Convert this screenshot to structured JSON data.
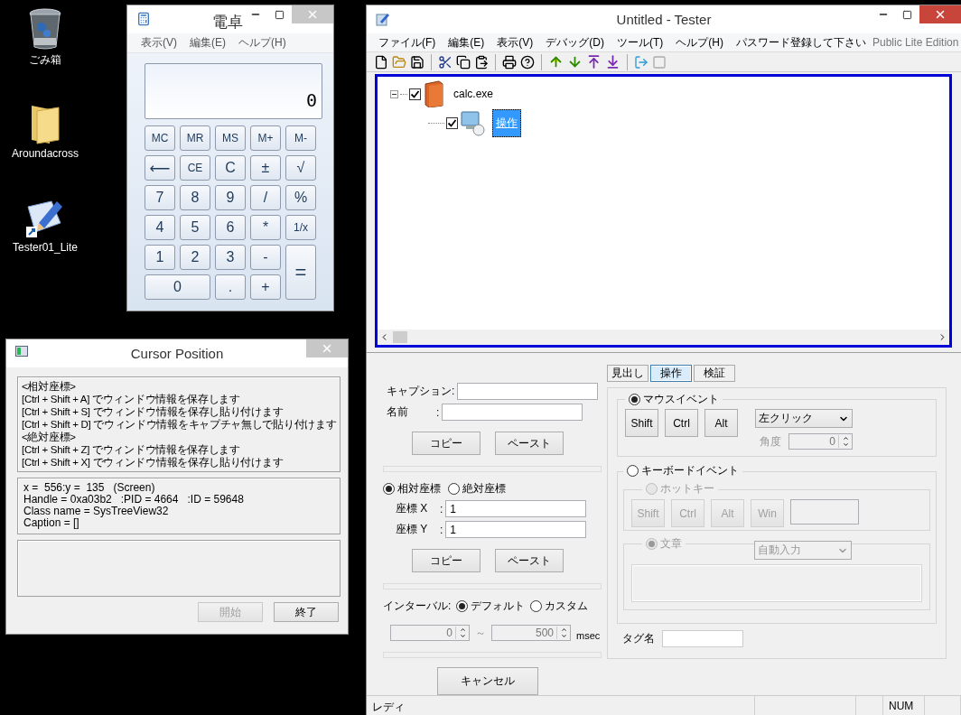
{
  "desktop_icons": [
    {
      "label": "ごみ箱",
      "kind": "trash"
    },
    {
      "label": "Aroundacross",
      "kind": "folder"
    },
    {
      "label": "Tester01_Lite",
      "kind": "shortcut"
    }
  ],
  "calculator": {
    "title": "電卓",
    "menu": [
      "表示(V)",
      "編集(E)",
      "ヘルプ(H)"
    ],
    "display": "0",
    "keys": [
      {
        "label": "MC",
        "kind": "key"
      },
      {
        "label": "MR",
        "kind": "key"
      },
      {
        "label": "MS",
        "kind": "key"
      },
      {
        "label": "M+",
        "kind": "key"
      },
      {
        "label": "M-",
        "kind": "key"
      },
      {
        "label": "⟵",
        "kind": "key"
      },
      {
        "label": "CE",
        "kind": "key"
      },
      {
        "label": "C",
        "kind": "key"
      },
      {
        "label": "±",
        "kind": "key"
      },
      {
        "label": "√",
        "kind": "key"
      },
      {
        "label": "7",
        "kind": "key"
      },
      {
        "label": "8",
        "kind": "key"
      },
      {
        "label": "9",
        "kind": "key"
      },
      {
        "label": "/",
        "kind": "key"
      },
      {
        "label": "%",
        "kind": "key"
      },
      {
        "label": "4",
        "kind": "key"
      },
      {
        "label": "5",
        "kind": "key"
      },
      {
        "label": "6",
        "kind": "key"
      },
      {
        "label": "*",
        "kind": "key"
      },
      {
        "label": "1/x",
        "kind": "key"
      },
      {
        "label": "1",
        "kind": "key"
      },
      {
        "label": "2",
        "kind": "key"
      },
      {
        "label": "3",
        "kind": "key"
      },
      {
        "label": "-",
        "kind": "key"
      },
      {
        "label": "=",
        "kind": "tall"
      },
      {
        "label": "0",
        "kind": "wide"
      },
      {
        "label": ".",
        "kind": "key"
      },
      {
        "label": "+",
        "kind": "key"
      }
    ]
  },
  "cursor_window": {
    "title": "Cursor Position",
    "hotkey_lines": [
      "<相対座標>",
      "[Ctrl + Shift + A] でウィンドウ情報を保存します",
      "[Ctrl + Shift + S] でウィンドウ情報を保存し貼り付けます",
      "[Ctrl + Shift + D] でウィンドウ情報をキャプチャ無しで貼り付けます",
      "<絶対座標>",
      "[Ctrl + Shift + Z] でウィンドウ情報を保存します",
      "[Ctrl + Shift + X] でウィンドウ情報を保存し貼り付けます"
    ],
    "info_lines": [
      "x =  556:y =  135   (Screen)",
      "Handle = 0xa03b2   :PID = 4664   :ID = 59648",
      "Class name = SysTreeView32",
      "Caption = []"
    ],
    "buttons": [
      {
        "label": "開始",
        "disabled": true
      },
      {
        "label": "終了",
        "disabled": false
      }
    ]
  },
  "tester": {
    "title": "Untitled - Tester",
    "menu": [
      "ファイル(F)",
      "編集(E)",
      "表示(V)",
      "デバッグ(D)",
      "ツール(T)",
      "ヘルプ(H)",
      "パスワード登録して下さい"
    ],
    "edition": "Public Lite Edition",
    "tree": [
      {
        "label": "calc.exe",
        "kind": "app",
        "checked": true,
        "expanded": true,
        "selected": false,
        "children": [
          {
            "label": "操作",
            "kind": "action",
            "checked": true,
            "selected": true
          }
        ]
      }
    ],
    "form": {
      "fields": [
        {
          "label": "キャプション:"
        },
        {
          "label": "名前",
          "sep": ":"
        }
      ],
      "buttons": [
        "コピー",
        "ペースト"
      ],
      "coord_modes": [
        {
          "label": "相対座標",
          "selected": true
        },
        {
          "label": "絶対座標",
          "selected": false
        }
      ],
      "coords": [
        {
          "label": "座標 X",
          "sep": ":",
          "value": "1"
        },
        {
          "label": "座標 Y",
          "sep": ":",
          "value": "1"
        }
      ],
      "coord_buttons": [
        "コピー",
        "ペースト"
      ],
      "interval": {
        "label": "インターバル:",
        "modes": [
          {
            "label": "デフォルト",
            "selected": true
          },
          {
            "label": "カスタム",
            "selected": false
          }
        ],
        "from": {
          "value": "0",
          "disabled": true
        },
        "range_sep": "～",
        "to": {
          "value": "500",
          "disabled": true
        },
        "unit": "msec"
      },
      "cancel": "キャンセル"
    },
    "tabs": [
      {
        "label": "見出し",
        "selected": false
      },
      {
        "label": "操作",
        "selected": true
      },
      {
        "label": "検証",
        "selected": false
      }
    ],
    "mouse_event": {
      "label": "マウスイベント",
      "selected": true,
      "buttons": [
        {
          "label": "Shift",
          "disabled": false
        },
        {
          "label": "Ctrl",
          "disabled": false
        },
        {
          "label": "Alt",
          "disabled": false
        }
      ],
      "action": {
        "value": "左クリック",
        "disabled": false
      },
      "angle": {
        "label": "角度",
        "value": "0",
        "disabled": true
      }
    },
    "keyboard_event": {
      "label": "キーボードイベント",
      "selected": false,
      "hotkey": {
        "label": "ホットキー",
        "selected": false,
        "disabled": true,
        "buttons": [
          {
            "label": "Shift",
            "disabled": true
          },
          {
            "label": "Ctrl",
            "disabled": true
          },
          {
            "label": "Alt",
            "disabled": true
          },
          {
            "label": "Win",
            "disabled": true
          }
        ]
      },
      "text": {
        "label": "文章",
        "selected": true,
        "disabled": true,
        "mode": {
          "value": "自動入力",
          "disabled": true
        }
      }
    },
    "tag": {
      "label": "タグ名"
    },
    "status_bar": {
      "message": "レディ",
      "num": "NUM"
    }
  }
}
